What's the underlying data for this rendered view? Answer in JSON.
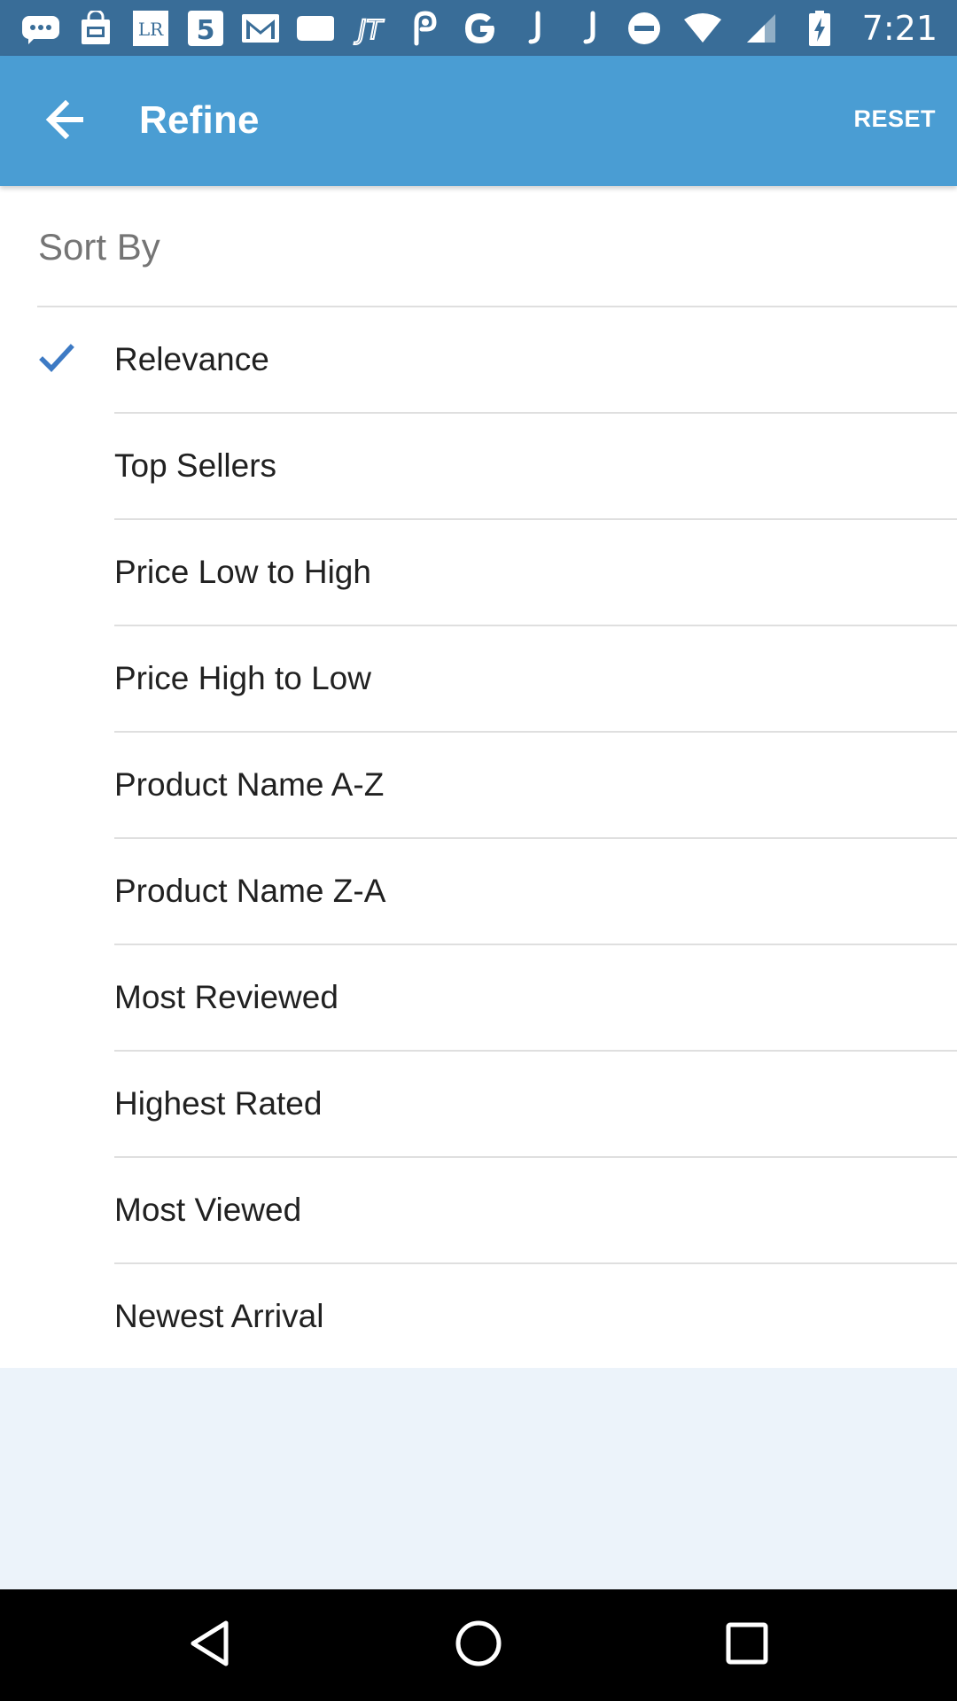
{
  "status_bar": {
    "time": "7:21",
    "left_icons": [
      "messages-icon",
      "shopping-bag-icon",
      "lr-app-icon",
      "html5-icon",
      "gmail-icon",
      "tag-icon",
      "jt-app-icon",
      "link-app-icon",
      "google-icon",
      "j-app-icon",
      "j-app-icon-2"
    ],
    "right_icons": [
      "do-not-disturb-icon",
      "wifi-icon",
      "cell-signal-icon",
      "battery-charging-icon"
    ],
    "lr_label": "LR",
    "jt_label": "JT"
  },
  "app_bar": {
    "title": "Refine",
    "reset_label": "RESET",
    "back_icon": "arrow-back-icon"
  },
  "sort_section": {
    "title": "Sort By",
    "selected_index": 0,
    "options": [
      {
        "label": "Relevance",
        "selected": true
      },
      {
        "label": "Top Sellers",
        "selected": false
      },
      {
        "label": "Price Low to High",
        "selected": false
      },
      {
        "label": "Price High to Low",
        "selected": false
      },
      {
        "label": "Product Name A-Z",
        "selected": false
      },
      {
        "label": "Product Name Z-A",
        "selected": false
      },
      {
        "label": "Most Reviewed",
        "selected": false
      },
      {
        "label": "Highest Rated",
        "selected": false
      },
      {
        "label": "Most Viewed",
        "selected": false
      },
      {
        "label": "Newest Arrival",
        "selected": false
      }
    ]
  },
  "nav_bar": {
    "icons": [
      "back-triangle-icon",
      "home-circle-icon",
      "recents-square-icon"
    ]
  },
  "colors": {
    "status_bar": "#396d98",
    "app_bar": "#4a9dd3",
    "check": "#3d7ac4",
    "background": "#ecf3fa"
  }
}
